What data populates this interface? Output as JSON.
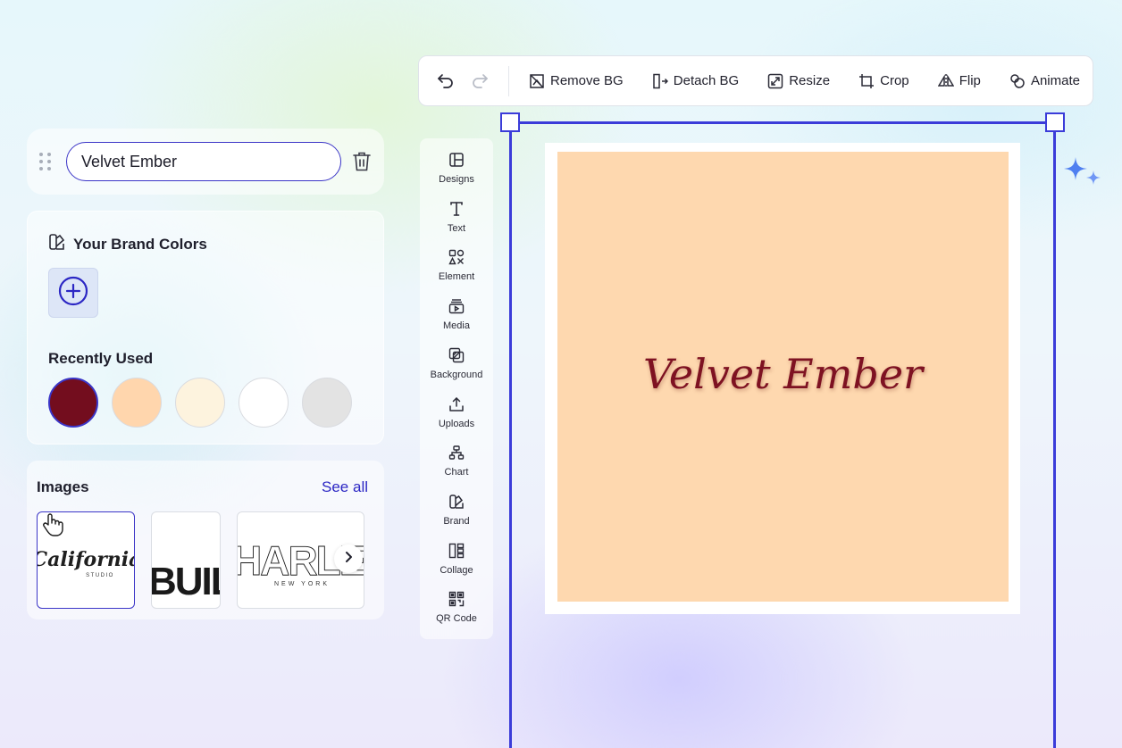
{
  "toolbar": {
    "undo_icon": "undo-icon",
    "redo_icon": "redo-icon",
    "tools": [
      {
        "label": "Remove BG",
        "icon": "remove-bg-icon"
      },
      {
        "label": "Detach BG",
        "icon": "detach-bg-icon"
      },
      {
        "label": "Resize",
        "icon": "resize-icon"
      },
      {
        "label": "Crop",
        "icon": "crop-icon"
      },
      {
        "label": "Flip",
        "icon": "flip-icon"
      },
      {
        "label": "Animate",
        "icon": "animate-icon"
      }
    ]
  },
  "palette": {
    "name": "Velvet Ember",
    "brand_colors_title": "Your Brand Colors",
    "recently_used_title": "Recently Used",
    "recent_colors": [
      "#730d1e",
      "#ffd6ad",
      "#fdf3de",
      "#ffffff",
      "#e3e3e3"
    ]
  },
  "images": {
    "title": "Images",
    "see_all": "See all",
    "thumbnails": [
      {
        "text": "California",
        "subtext": "STUDIO"
      },
      {
        "text": "BUILT"
      },
      {
        "text": "HARLEM",
        "subtext": "NEW YORK"
      }
    ]
  },
  "side_tools": [
    {
      "label": "Designs",
      "icon": "designs-icon"
    },
    {
      "label": "Text",
      "icon": "text-icon"
    },
    {
      "label": "Element",
      "icon": "element-icon"
    },
    {
      "label": "Media",
      "icon": "media-icon"
    },
    {
      "label": "Background",
      "icon": "background-icon"
    },
    {
      "label": "Uploads",
      "icon": "uploads-icon"
    },
    {
      "label": "Chart",
      "icon": "chart-icon"
    },
    {
      "label": "Brand",
      "icon": "brand-icon"
    },
    {
      "label": "Collage",
      "icon": "collage-icon"
    },
    {
      "label": "QR Code",
      "icon": "qr-code-icon"
    }
  ],
  "canvas": {
    "text": "Velvet Ember",
    "background_color": "#fed8af",
    "text_color": "#7e1222",
    "selection_color": "#3b3cd9"
  }
}
